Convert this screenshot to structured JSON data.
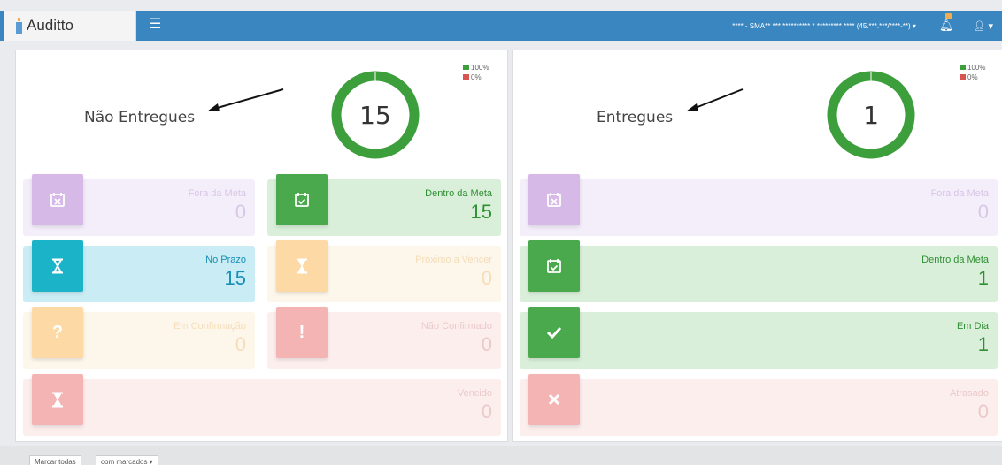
{
  "app": {
    "name": "Auditto"
  },
  "topbar": {
    "entity": "**** - SMA** *** ********** * ********* **** (45.***.***/****-**) ▾",
    "user_caret": "▾"
  },
  "left_panel": {
    "title": "Não Entregues",
    "total": "15",
    "legend": [
      {
        "label": "100%",
        "color": "#3c9f3c"
      },
      {
        "label": "0%",
        "color": "#d9534f"
      }
    ],
    "donut": {
      "green_fraction": 1.0
    },
    "cards": [
      {
        "label": "Fora da Meta",
        "value": "0",
        "icon": "calendar-x-icon"
      },
      {
        "label": "Dentro da Meta",
        "value": "15",
        "icon": "calendar-check-icon"
      },
      {
        "label": "No Prazo",
        "value": "15",
        "icon": "hourglass-icon"
      },
      {
        "label": "Próximo a Vencer",
        "value": "0",
        "icon": "hourglass-icon"
      },
      {
        "label": "Em Confirmação",
        "value": "0",
        "icon": "question-icon"
      },
      {
        "label": "Não Confirmado",
        "value": "0",
        "icon": "exclamation-icon"
      },
      {
        "label": "Vencido",
        "value": "0",
        "icon": "hourglass-icon"
      }
    ]
  },
  "right_panel": {
    "title": "Entregues",
    "total": "1",
    "legend": [
      {
        "label": "100%",
        "color": "#3c9f3c"
      },
      {
        "label": "0%",
        "color": "#d9534f"
      }
    ],
    "donut": {
      "green_fraction": 1.0
    },
    "cards": [
      {
        "label": "Fora da Meta",
        "value": "0",
        "icon": "calendar-x-icon"
      },
      {
        "label": "Dentro da Meta",
        "value": "1",
        "icon": "calendar-check-icon"
      },
      {
        "label": "Em Dia",
        "value": "1",
        "icon": "check-icon"
      },
      {
        "label": "Atrasado",
        "value": "0",
        "icon": "times-icon"
      }
    ]
  },
  "footer": {
    "mark_all": "Marcar todas",
    "with_marked": "com marcados ▾"
  },
  "colors": {
    "topbar": "#3a86c0",
    "green": "#4aa94c",
    "cyan": "#1ab3c7",
    "purple": "#d7b9e8",
    "orange": "#fcd9a5",
    "red": "#f4b4b4"
  }
}
